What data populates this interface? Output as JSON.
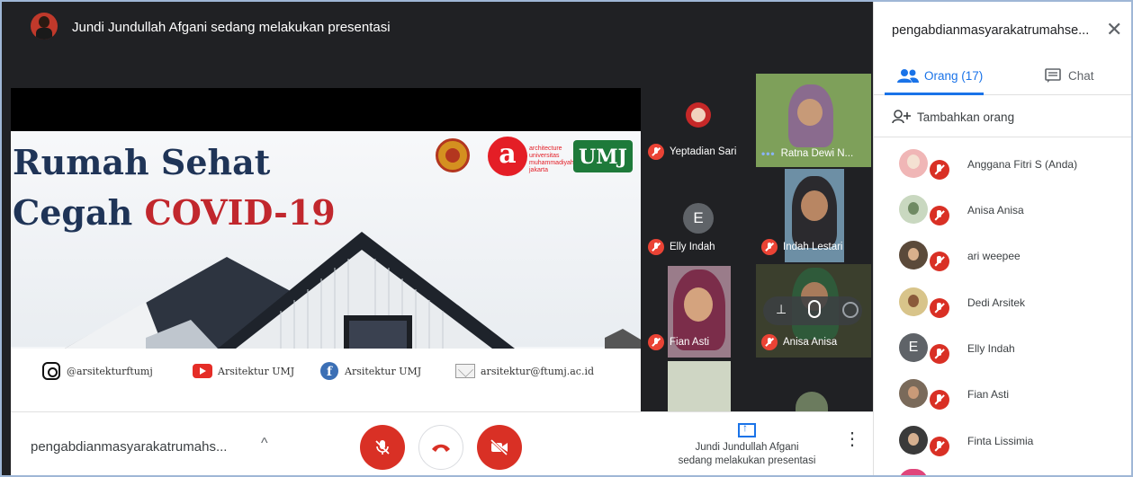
{
  "presenter_banner": {
    "text": "Jundi Jundullah Afgani sedang melakukan presentasi"
  },
  "slide": {
    "title_line1": "Rumah Sehat",
    "title_line2_prefix": "Cegah ",
    "title_line2_highlight": "COVID-19",
    "logo_umj": "UMJ",
    "logo_arch_letter": "a",
    "logo_arch_text": "architecture universitas muhammadiyah jakarta",
    "social": [
      {
        "icon": "instagram-icon",
        "label": "@arsitekturftumj"
      },
      {
        "icon": "youtube-icon",
        "label": "Arsitektur UMJ"
      },
      {
        "icon": "facebook-icon",
        "label": "Arsitektur UMJ"
      },
      {
        "icon": "email-icon",
        "label": "arsitektur@ftumj.ac.id"
      }
    ]
  },
  "tiles": [
    {
      "name": "Yeptadian Sari",
      "muted": true
    },
    {
      "name": "Ratna Dewi N...",
      "muted": false
    },
    {
      "name": "Elly Indah",
      "muted": true,
      "letter": "E"
    },
    {
      "name": "Indah Lestari",
      "muted": true
    },
    {
      "name": "Fian Asti",
      "muted": true
    },
    {
      "name": "Anisa Anisa",
      "muted": true
    }
  ],
  "bottombar": {
    "meeting_name": "pengabdianmasyarakatrumahs...",
    "caret": "^",
    "present_line1": "Jundi Jundullah Afgani",
    "present_line2": "sedang melakukan presentasi",
    "more": "⋮"
  },
  "panel": {
    "title": "pengabdianmasyarakatrumahse...",
    "close": "✕",
    "tab_people": "Orang (17)",
    "tab_chat": "Chat",
    "add_people": "Tambahkan orang",
    "people": [
      {
        "name": "Anggana Fitri S (Anda)"
      },
      {
        "name": "Anisa Anisa"
      },
      {
        "name": "ari weepee"
      },
      {
        "name": "Dedi Arsitek"
      },
      {
        "name": "Elly Indah",
        "letter": "E"
      },
      {
        "name": "Fian Asti"
      },
      {
        "name": "Finta Lissimia"
      }
    ]
  },
  "colors": {
    "accent": "#1a73e8",
    "danger": "#d93025",
    "dark": "#202124"
  }
}
